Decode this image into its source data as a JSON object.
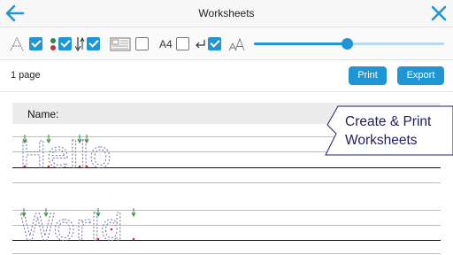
{
  "titlebar": {
    "title": "Worksheets",
    "back_icon": "back-arrow-icon",
    "close_icon": "close-icon"
  },
  "toolbar": {
    "font_toggle": {
      "icon": "font-style-icon",
      "checked": true
    },
    "color_dots_toggle": {
      "icon": "color-dots-icon",
      "checked": true
    },
    "stroke_direction_toggle": {
      "icon": "stroke-arrow-icon",
      "checked": true
    },
    "example_toggle": {
      "icon": "text-block-icon",
      "checked": false
    },
    "paper_size": {
      "label": "A4",
      "checked": false
    },
    "return_toggle": {
      "icon": "return-arrow-icon",
      "checked": true
    },
    "size_icon": "font-size-icon",
    "size_slider": {
      "value": 0.49
    }
  },
  "actions": {
    "page_count": "1 page",
    "print_label": "Print",
    "export_label": "Export"
  },
  "worksheet": {
    "name_label": "Name:",
    "lines": [
      "Hello",
      "World"
    ]
  },
  "callout": {
    "line1": "Create & Print",
    "line2": "Worksheets"
  },
  "colors": {
    "accent": "#1e96d6",
    "slider_track": "#b7d8ee",
    "tracing": "#6f72a6",
    "callout_text": "#1f2060",
    "stroke_start": "#2e8b3e",
    "stroke_end": "#d0312d"
  }
}
